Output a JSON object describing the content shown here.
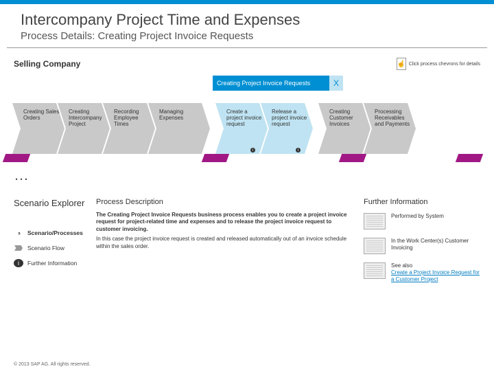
{
  "header": {
    "title": "Intercompany Project Time and Expenses",
    "subtitle": "Process Details: Creating Project Invoice Requests"
  },
  "subhead": {
    "company": "Selling Company",
    "hint": "Click process chevrons for details"
  },
  "highlight": {
    "label": "Creating Project Invoice Requests",
    "close": "X"
  },
  "chevrons": [
    {
      "label": "Creating Sales Orders",
      "highlight": false
    },
    {
      "label": "Creating Intercompany Project",
      "highlight": false
    },
    {
      "label": "Recording Employee Times",
      "highlight": false
    },
    {
      "label": "Managing Expenses",
      "highlight": false
    },
    {
      "label": "Create a project invoice request",
      "highlight": true,
      "info": true
    },
    {
      "label": "Release a project invoice request",
      "highlight": true,
      "info": true
    },
    {
      "label": "Creating Customer Invoices",
      "highlight": false
    },
    {
      "label": "Processing Receivables and Payments",
      "highlight": false
    }
  ],
  "sidebar": {
    "heading": "Scenario Explorer",
    "items": [
      {
        "label": "Scenario/Processes",
        "icon": "chevs",
        "bold": true
      },
      {
        "label": "Scenario Flow",
        "icon": "flow",
        "bold": false
      },
      {
        "label": "Further Information",
        "icon": "info",
        "bold": false
      }
    ]
  },
  "desc": {
    "heading": "Process Description",
    "p1": "The Creating Project Invoice Requests business process enables you to create a project invoice request for project-related time and expenses and to release the project invoice request to customer invoicing.",
    "p2": "In this case the project invoice request is created and released automatically out of an invoice schedule within the sales order."
  },
  "right": {
    "heading": "Further Information",
    "rows": [
      {
        "text": "Performed by System"
      },
      {
        "text": "In the Work Center(s) Customer Invoicing"
      },
      {
        "text": "See also",
        "link": "Create a Project Invoice Request for a Customer Project"
      }
    ]
  },
  "footer": "© 2013 SAP AG. All rights reserved."
}
